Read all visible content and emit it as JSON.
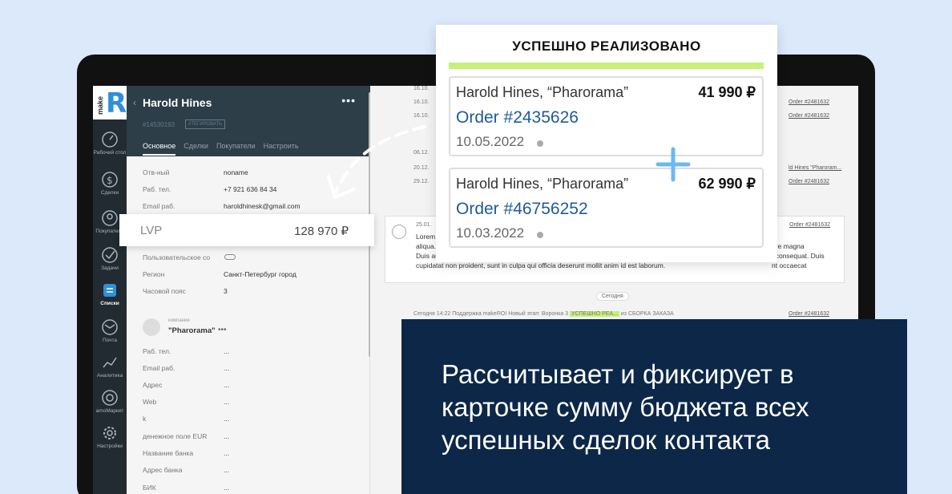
{
  "brand": {
    "logo_word": "make",
    "logo_letter": "R"
  },
  "nav": [
    {
      "label": "Рабочий стол",
      "icon": "dashboard-icon"
    },
    {
      "label": "Сделки",
      "icon": "dollar-icon"
    },
    {
      "label": "Покупатели",
      "icon": "buyers-icon"
    },
    {
      "label": "Задачи",
      "icon": "tasks-icon"
    },
    {
      "label": "Списки",
      "icon": "lists-icon",
      "active": true
    },
    {
      "label": "Почта",
      "icon": "mail-icon"
    },
    {
      "label": "Аналитика",
      "icon": "analytics-icon"
    },
    {
      "label": "amoМаркет",
      "icon": "market-icon"
    },
    {
      "label": "Настройки",
      "icon": "settings-icon"
    }
  ],
  "contact": {
    "name": "Harold Hines",
    "id": "#14530193",
    "tag": "#ТЕГИРОВАТЬ",
    "tabs": [
      "Основное",
      "Сделки",
      "Покупатели",
      "Настроить"
    ],
    "fields": [
      {
        "label": "Отв-ный",
        "value": "noname"
      },
      {
        "label": "Раб. тел.",
        "value": "+7 921 636 84 34"
      },
      {
        "label": "Email раб.",
        "value": "haroldhinesk@gmail.com"
      },
      {
        "label": "Пользовательское со",
        "value": ""
      },
      {
        "label": "Регион",
        "value": "Санкт-Петербург город"
      },
      {
        "label": "Часовой пояс",
        "value": "3"
      }
    ]
  },
  "company": {
    "label": "компания",
    "name": "\"Pharorama\"",
    "fields": [
      {
        "label": "Раб. тел.",
        "value": "..."
      },
      {
        "label": "Email раб.",
        "value": "..."
      },
      {
        "label": "Адрес",
        "value": "..."
      },
      {
        "label": "Web",
        "value": "..."
      },
      {
        "label": "k",
        "value": "..."
      },
      {
        "label": "денежное поле EUR",
        "value": "..."
      },
      {
        "label": "Название банка",
        "value": "..."
      },
      {
        "label": "Адрес банка",
        "value": "..."
      },
      {
        "label": "БИК",
        "value": "..."
      }
    ]
  },
  "lvp": {
    "label": "LVP",
    "value": "128 970 ₽"
  },
  "feed": {
    "dates": [
      "16.10.",
      "16.10.",
      "16.10.",
      "06.12.",
      "20.12.",
      "29.12."
    ],
    "links": [
      "Order #2481632",
      "Order #2481632",
      "ld Hines \"Pharoram...",
      "Order #2481632"
    ],
    "note": {
      "date": "25.01.",
      "link": "Order #2481632",
      "text": "Lorem ... aliqua. ... Duis aute ir... cupidatat non proident, sunt in culpa qui officia deserunt mollit anim id est laborum.",
      "line1": "Lorem",
      "line2": "aliqua.",
      "line3": "Duis aute ir",
      "line4": "cupidatat non proident, sunt in culpa qui officia deserunt mollit anim id est laborum.",
      "right1": "ore magna",
      "right2": "t consequat. Duis",
      "right3": "nt occaecat"
    },
    "today": "Сегодня",
    "event": {
      "time": "Сегодня 14:22 Поддержка makeROI Новый этап:",
      "pipeline": "Воронка 3",
      "stage": "УСПЕШНО РЕА...",
      "from": "из СБОРКА ЗАКАЗА",
      "link": "Order #2481632"
    }
  },
  "popup": {
    "title": "УСПЕШНО РЕАЛИЗОВАНО",
    "orders": [
      {
        "client": "Harold Hines, “Pharorama”",
        "sum": "41 990 ₽",
        "order": "Order #2435626",
        "date": "10.05.2022"
      },
      {
        "client": "Harold Hines, “Pharorama”",
        "sum": "62 990 ₽",
        "order": "Order #46756252",
        "date": "10.03.2022"
      }
    ]
  },
  "caption": "Рассчитывает и фиксирует в карточке сумму бюджета всех успешных сделок контакта",
  "colors": {
    "accent_green": "#c7f07a",
    "caption_bg": "#0c2747",
    "order_blue": "#1e5b97",
    "plus_blue": "#6cb8f0"
  }
}
